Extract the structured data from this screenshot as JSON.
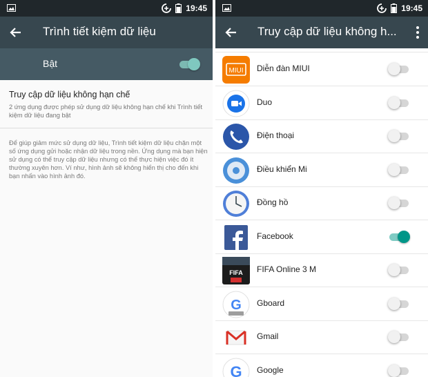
{
  "left": {
    "status_time": "19:45",
    "title": "Trình tiết kiệm dữ liệu",
    "toggle_label": "Bật",
    "toggle_on": true,
    "unrestricted_title": "Truy cập dữ liệu không hạn chế",
    "unrestricted_summary": "2 ứng dụng được phép sử dụng dữ liệu không hạn chế khi Trình tiết kiệm dữ liệu đang bật",
    "description": "Để giúp giảm mức sử dụng dữ liệu, Trình tiết kiệm dữ liệu chặn một số ứng dụng gửi hoặc nhận dữ liệu trong nền. Ứng dụng mà bạn hiện sử dụng có thể truy cập dữ liệu nhưng có thể thực hiện việc đó ít thường xuyên hơn. Ví như, hình ảnh sẽ không hiển thị cho đến khi bạn nhấn vào hình ảnh đó."
  },
  "right": {
    "status_time": "19:45",
    "title": "Truy cập dữ liệu không h...",
    "apps": [
      {
        "name": "Diễn đàn MIUI",
        "icon": "miui-forum-icon",
        "on": false
      },
      {
        "name": "Duo",
        "icon": "duo-icon",
        "on": false
      },
      {
        "name": "Điện thoại",
        "icon": "phone-icon",
        "on": false
      },
      {
        "name": "Điều khiển Mi",
        "icon": "mi-remote-icon",
        "on": false
      },
      {
        "name": "Đồng hồ",
        "icon": "clock-icon",
        "on": false
      },
      {
        "name": "Facebook",
        "icon": "facebook-icon",
        "on": true
      },
      {
        "name": "FIFA Online 3 M",
        "icon": "fifa-online-icon",
        "on": false
      },
      {
        "name": "Gboard",
        "icon": "gboard-icon",
        "on": false
      },
      {
        "name": "Gmail",
        "icon": "gmail-icon",
        "on": false
      },
      {
        "name": "Google",
        "icon": "google-icon",
        "on": false
      }
    ]
  },
  "colors": {
    "appbar": "#37474f",
    "statusbar": "#20272b",
    "accent": "#009688"
  }
}
